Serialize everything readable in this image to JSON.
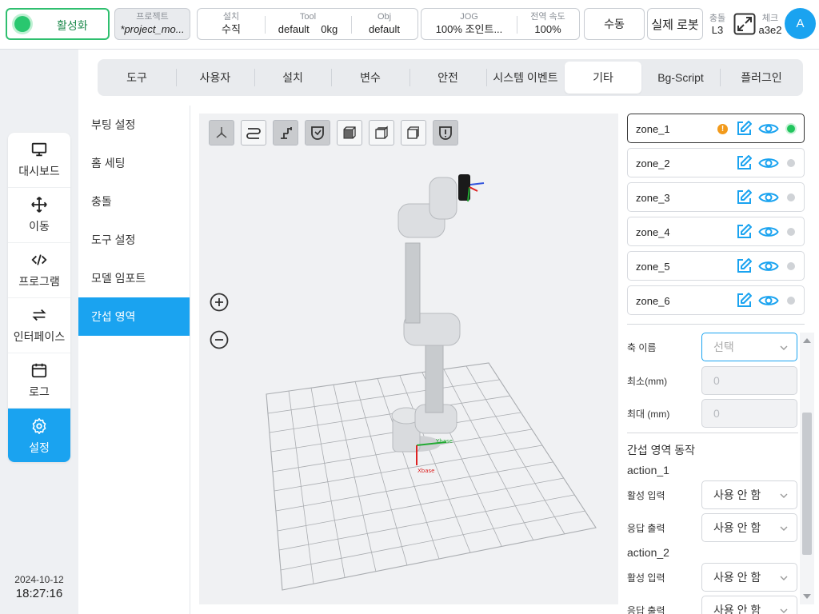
{
  "topbar": {
    "activate_label": "활성화",
    "project": {
      "title": "프로젝트",
      "value": "*project_mo..."
    },
    "setup": [
      {
        "title": "설치",
        "value": "수직"
      },
      {
        "title": "Tool",
        "value": "default    0kg"
      },
      {
        "title": "Obj",
        "value": "default"
      }
    ],
    "jog": [
      {
        "title": "JOG",
        "value": "100%  조인트..."
      },
      {
        "title": "전역 속도",
        "value": "100%"
      }
    ],
    "manual_label": "수동",
    "real_robot_label": "실제 로봇",
    "collision": {
      "title": "충돌",
      "value": "L3"
    },
    "check": {
      "title": "체크",
      "value": "a3e2"
    },
    "avatar_letter": "A"
  },
  "nav": {
    "items": [
      {
        "label": "대시보드",
        "icon": "monitor-icon"
      },
      {
        "label": "이동",
        "icon": "move-icon"
      },
      {
        "label": "프로그램",
        "icon": "code-icon"
      },
      {
        "label": "인터페이스",
        "icon": "swap-icon"
      },
      {
        "label": "로그",
        "icon": "calendar-icon"
      },
      {
        "label": "설정",
        "icon": "gear-icon"
      }
    ],
    "active_index": 5
  },
  "datetime": {
    "date": "2024-10-12",
    "time": "18:27:16"
  },
  "tabs": [
    "도구",
    "사용자",
    "설치",
    "변수",
    "안전",
    "시스템 이벤트",
    "기타",
    "Bg-Script",
    "플러그인"
  ],
  "active_tab": 6,
  "submenu": {
    "items": [
      "부팅 설정",
      "홈 세팅",
      "충돌",
      "도구 설정",
      "모델 임포트",
      "간섭 영역"
    ],
    "active_index": 5
  },
  "view3d": {
    "axis_labels": {
      "x": "Xbase",
      "y": "Ybase"
    }
  },
  "zones": [
    {
      "name": "zone_1",
      "warning": "!",
      "active": true
    },
    {
      "name": "zone_2",
      "active": false
    },
    {
      "name": "zone_3",
      "active": false
    },
    {
      "name": "zone_4",
      "active": false
    },
    {
      "name": "zone_5",
      "active": false
    },
    {
      "name": "zone_6",
      "active": false
    }
  ],
  "form": {
    "axis_name_label": "축 이름",
    "axis_name_placeholder": "선택",
    "min_label": "최소(mm)",
    "min_value": "0",
    "max_label": "최대 (mm)",
    "max_value": "0",
    "section_title": "간섭 영역 동작",
    "actions": [
      {
        "name": "action_1",
        "input_label": "활성 입력",
        "input_value": "사용 안 함",
        "output_label": "응답 출력",
        "output_value": "사용 안 함"
      },
      {
        "name": "action_2",
        "input_label": "활성 입력",
        "input_value": "사용 안 함",
        "output_label": "응답 출력",
        "output_value": "사용 안 함"
      }
    ]
  },
  "colors": {
    "accent": "#1aa3f0",
    "active_green": "#29c76f",
    "warning": "#f29a1b"
  }
}
